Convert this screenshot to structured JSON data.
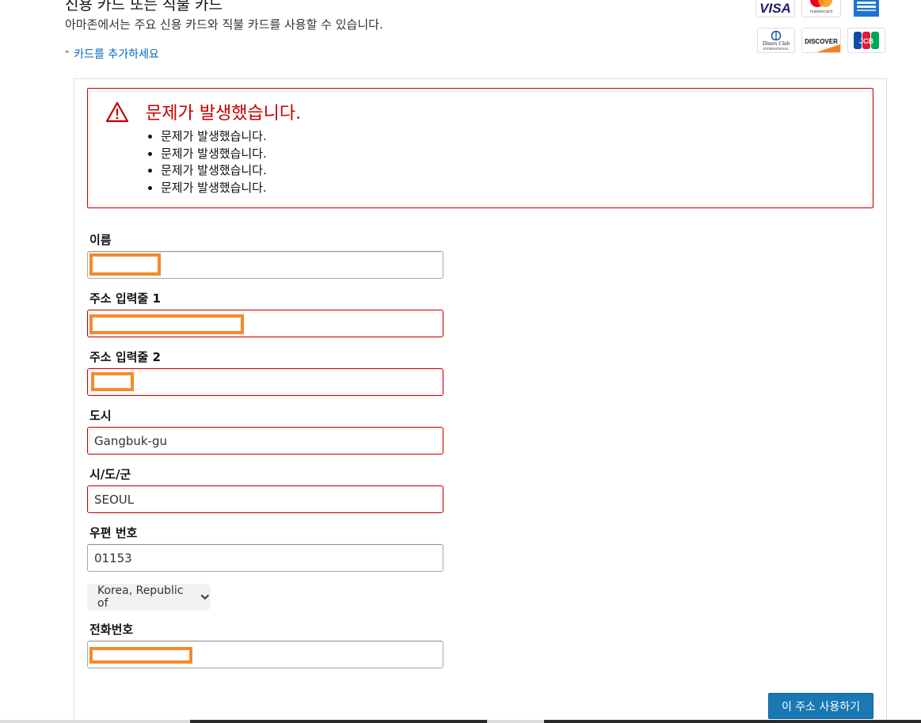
{
  "header": {
    "title": "신용 카드 또는 직불 카드",
    "subtitle": "아마존에서는 주요 신용 카드와 직불 카드를 사용할 수 있습니다.",
    "add_card_link": "카드를 추가하세요"
  },
  "card_logos": {
    "visa": "VISA",
    "discover": "DISCOVER",
    "jcb": "JCB",
    "diners": "Diners Club",
    "diners_sub": "INTERNATIONAL",
    "mastercard_sub": "mastercard"
  },
  "alert": {
    "title": "문제가 발생했습니다.",
    "items": [
      "문제가 발생했습니다.",
      "문제가 발생했습니다.",
      "문제가 발생했습니다.",
      "문제가 발생했습니다."
    ],
    "color": "#c40000"
  },
  "form": {
    "name": {
      "label": "이름",
      "value": ""
    },
    "address1": {
      "label": "주소 입력줄 1",
      "value": ""
    },
    "address2": {
      "label": "주소 입력줄 2",
      "value": ""
    },
    "city": {
      "label": "도시",
      "value": "Gangbuk-gu"
    },
    "state": {
      "label": "시/도/군",
      "value": "SEOUL"
    },
    "postal": {
      "label": "우편 번호",
      "value": "01153"
    },
    "country": {
      "value": "Korea, Republic of"
    },
    "phone": {
      "label": "전화번호",
      "value": ""
    }
  },
  "submit_label": "이 주소 사용하기",
  "colors": {
    "link": "#0066c0",
    "error": "#c40000",
    "primary_button": "#1a78b4",
    "redaction": "#f58a2b"
  }
}
